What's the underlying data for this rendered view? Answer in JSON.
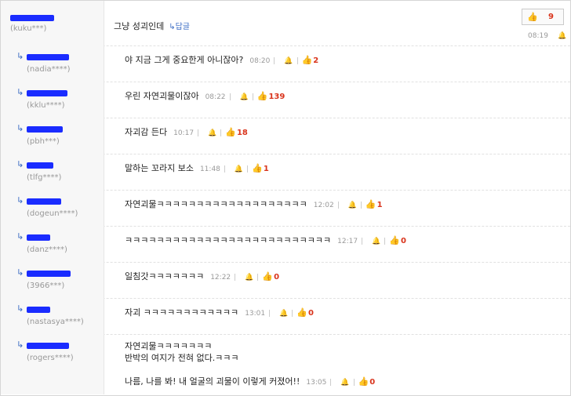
{
  "top_comment": {
    "user_id": "(kuku***)",
    "text": "그냥 성괴인데",
    "reply_label": "↳답글",
    "likes": "9",
    "time": "08:19"
  },
  "replies": [
    {
      "user_id": "(nadia****)",
      "lines": [
        "야 지금 그게 중요한게 아니잖아?"
      ],
      "time": "08:20",
      "likes": "2"
    },
    {
      "user_id": "(kklu****)",
      "lines": [
        "우린 자연괴물이잖아"
      ],
      "time": "08:22",
      "likes": "139"
    },
    {
      "user_id": "(pbh***)",
      "lines": [
        "자괴감 든다"
      ],
      "time": "10:17",
      "likes": "18"
    },
    {
      "user_id": "(tlfg****)",
      "lines": [
        "말하는 꼬라지 보소"
      ],
      "time": "11:48",
      "likes": "1"
    },
    {
      "user_id": "(dogeun****)",
      "lines": [
        "자연괴물ㅋㅋㅋㅋㅋㅋㅋㅋㅋㅋㅋㅋㅋㅋㅋㅋㅋㅋㅋ"
      ],
      "time": "12:02",
      "likes": "1"
    },
    {
      "user_id": "(danz****)",
      "lines": [
        "ㅋㅋㅋㅋㅋㅋㅋㅋㅋㅋㅋㅋㅋㅋㅋㅋㅋㅋㅋㅋㅋㅋㅋㅋㅋㅋ"
      ],
      "time": "12:17",
      "likes": "0"
    },
    {
      "user_id": "(3966***)",
      "lines": [
        "일침갓ㅋㅋㅋㅋㅋㅋㅋ"
      ],
      "time": "12:22",
      "likes": "0"
    },
    {
      "user_id": "(nastasya****)",
      "lines": [
        "자괴 ㅋㅋㅋㅋㅋㅋㅋㅋㅋㅋㅋㅋ"
      ],
      "time": "13:01",
      "likes": "0"
    },
    {
      "user_id": "(rogers****)",
      "lines": [
        "자연괴물ㅋㅋㅋㅋㅋㅋㅋ",
        "반박의 여지가 전혀 없다.ㅋㅋㅋ",
        "나름, 나를 봐! 내 얼굴의 괴물이 이렇게 커졌어!!"
      ],
      "time": "13:05",
      "likes": "0"
    }
  ],
  "colors": {
    "accent": "#3b6cc4",
    "like_count": "#d9341c",
    "redaction": "#1a2cff"
  },
  "icons": {
    "reply_arrow": "reply-arrow-icon",
    "thumb": "thumbs-up-icon",
    "bell": "report-icon"
  }
}
